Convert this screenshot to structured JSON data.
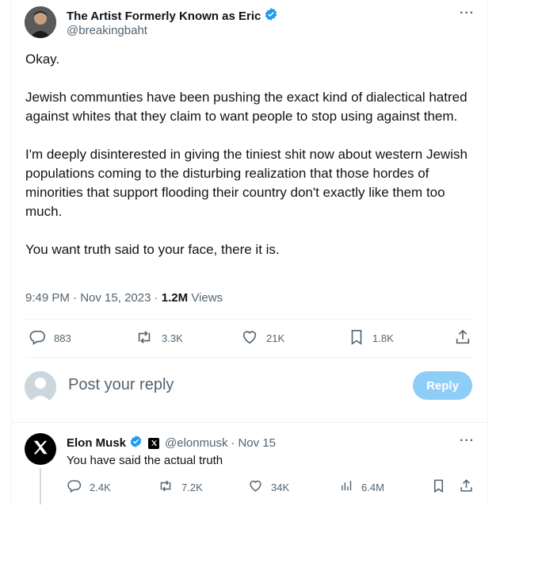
{
  "tweet": {
    "display_name": "The Artist Formerly Known as Eric",
    "handle": "@breakingbaht",
    "paragraphs": [
      "Okay.",
      "Jewish communties have been pushing the exact kind of dialectical hatred against whites that they claim to want people to stop using against them.",
      "I'm deeply disinterested in giving the tiniest shit now about western Jewish populations coming to the disturbing realization that those hordes of minorities that support flooding their country don't exactly like them too much.",
      "You want truth said to your face, there it is."
    ],
    "time": "9:49 PM",
    "date": "Nov 15, 2023",
    "views_count": "1.2M",
    "views_label": "Views",
    "replies": "883",
    "reposts": "3.3K",
    "likes": "21K",
    "bookmarks": "1.8K",
    "more_glyph": "···",
    "sep": "·"
  },
  "composer": {
    "placeholder": "Post your reply",
    "reply_button": "Reply"
  },
  "reply": {
    "display_name": "Elon Musk",
    "handle": "@elonmusk",
    "sep": "·",
    "date": "Nov 15",
    "text": "You have said the actual truth",
    "replies": "2.4K",
    "reposts": "7.2K",
    "likes": "34K",
    "views": "6.4M",
    "more_glyph": "···"
  },
  "colors": {
    "verified": "#1d9bf0",
    "secondary_text": "#536471",
    "reply_button_bg": "#8ecdf8",
    "divider": "#eff3f4"
  }
}
